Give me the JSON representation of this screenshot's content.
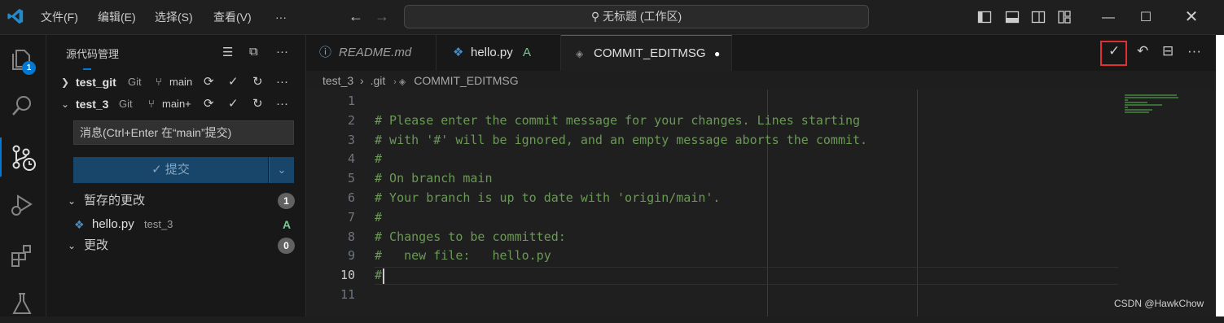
{
  "titlebar": {
    "menus": [
      "文件(F)",
      "编辑(E)",
      "选择(S)",
      "查看(V)",
      "···"
    ],
    "search_text": "无标题 (工作区)"
  },
  "activity": {
    "badge": "1"
  },
  "sidebar": {
    "title": "源代码管理",
    "repos": [
      {
        "name": "test_git",
        "provider": "Git",
        "branch": "main"
      },
      {
        "name": "test_3",
        "provider": "Git",
        "branch": "main+"
      }
    ],
    "message_placeholder": "消息(Ctrl+Enter 在“main”提交)",
    "commit_label": "✓ 提交",
    "staged": {
      "label": "暂存的更改",
      "count": "1"
    },
    "staged_file": {
      "name": "hello.py",
      "folder": "test_3",
      "status": "A"
    },
    "changes": {
      "label": "更改",
      "count": "0"
    }
  },
  "tabs": [
    {
      "label": "README.md"
    },
    {
      "label": "hello.py",
      "status": "A"
    },
    {
      "label": "COMMIT_EDITMSG"
    }
  ],
  "breadcrumb": [
    "test_3",
    ".git",
    "COMMIT_EDITMSG"
  ],
  "editor": {
    "current_line": 10,
    "lines": [
      "",
      "# Please enter the commit message for your changes. Lines starting",
      "# with '#' will be ignored, and an empty message aborts the commit.",
      "#",
      "# On branch main",
      "# Your branch is up to date with 'origin/main'.",
      "#",
      "# Changes to be committed:",
      "#\tnew file:   hello.py",
      "#",
      ""
    ]
  },
  "watermark": "CSDN @HawkChow",
  "colors": {
    "accent": "#0078d4",
    "comment": "#6a9955",
    "highlight": "#e03030"
  }
}
